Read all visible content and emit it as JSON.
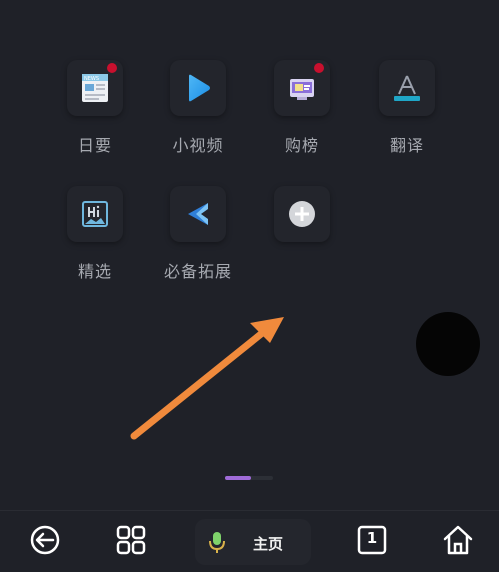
{
  "apps_row1": [
    {
      "label": "日要",
      "icon": "news-icon",
      "badge": true
    },
    {
      "label": "小视频",
      "icon": "play-icon",
      "badge": false
    },
    {
      "label": "购榜",
      "icon": "shop-ranking-icon",
      "badge": true
    },
    {
      "label": "翻译",
      "icon": "translate-icon",
      "badge": false
    }
  ],
  "apps_row2": [
    {
      "label": "精选",
      "icon": "featured-icon",
      "badge": false
    },
    {
      "label": "必备拓展",
      "icon": "extension-icon",
      "badge": false
    },
    {
      "label": "",
      "icon": "add-icon",
      "badge": false
    }
  ],
  "bottom_nav": {
    "home_label": "主页",
    "tab_count": "1"
  },
  "colors": {
    "background": "#1f2128",
    "accent_arrow": "#f08a3c",
    "indicator_active": "#9f6bd8",
    "badge": "#c8102e",
    "mic_green": "#7fd36b"
  }
}
